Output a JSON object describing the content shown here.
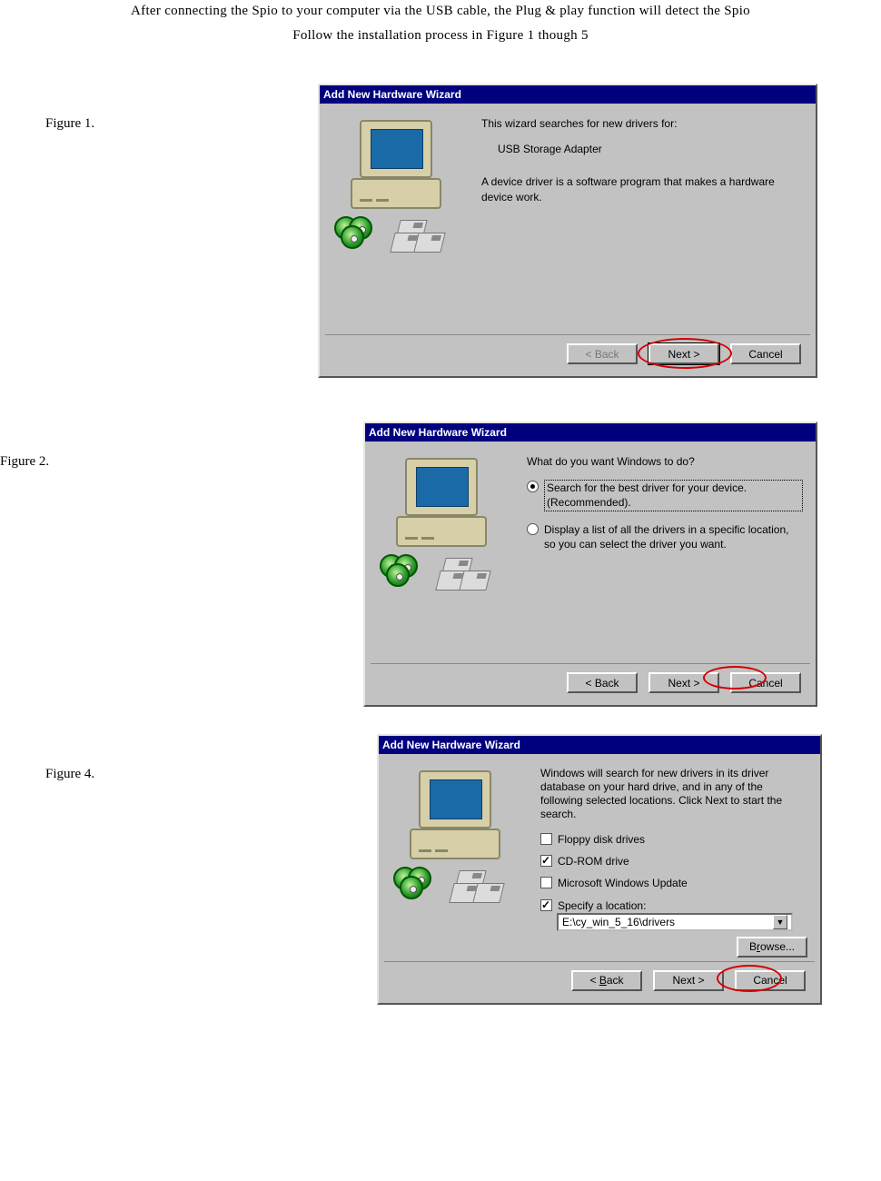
{
  "intro": {
    "line1": "After connecting the Spio to your computer via the USB cable, the Plug & play function will detect the Spio",
    "line2": "Follow the installation process in Figure 1 though 5"
  },
  "labels": {
    "fig1": "Figure 1.",
    "fig2": "Figure 2.",
    "fig4": "Figure 4."
  },
  "dialogs": {
    "title": "Add New Hardware Wizard",
    "buttons": {
      "back": "< Back",
      "next": "Next >",
      "cancel": "Cancel",
      "browse": "Browse..."
    },
    "fig1": {
      "desc": "This wizard searches for new drivers for:",
      "device": "USB Storage Adapter",
      "explain": "A device driver is a software program that makes a hardware device work."
    },
    "fig2": {
      "question": "What do you want Windows to do?",
      "opt1": "Search for the best driver for your device. (Recommended).",
      "opt2": "Display a list of all the drivers in a specific location, so you can select the driver you want."
    },
    "fig4": {
      "desc": "Windows will search for new drivers in its driver database on your hard drive, and in any of the following selected locations. Click Next to start the search.",
      "opt_floppy": "Floppy disk drives",
      "opt_cdrom": "CD-ROM drive",
      "opt_update": "Microsoft Windows Update",
      "opt_specify": "Specify a location:",
      "location_value": "E:\\cy_win_5_16\\drivers"
    }
  }
}
